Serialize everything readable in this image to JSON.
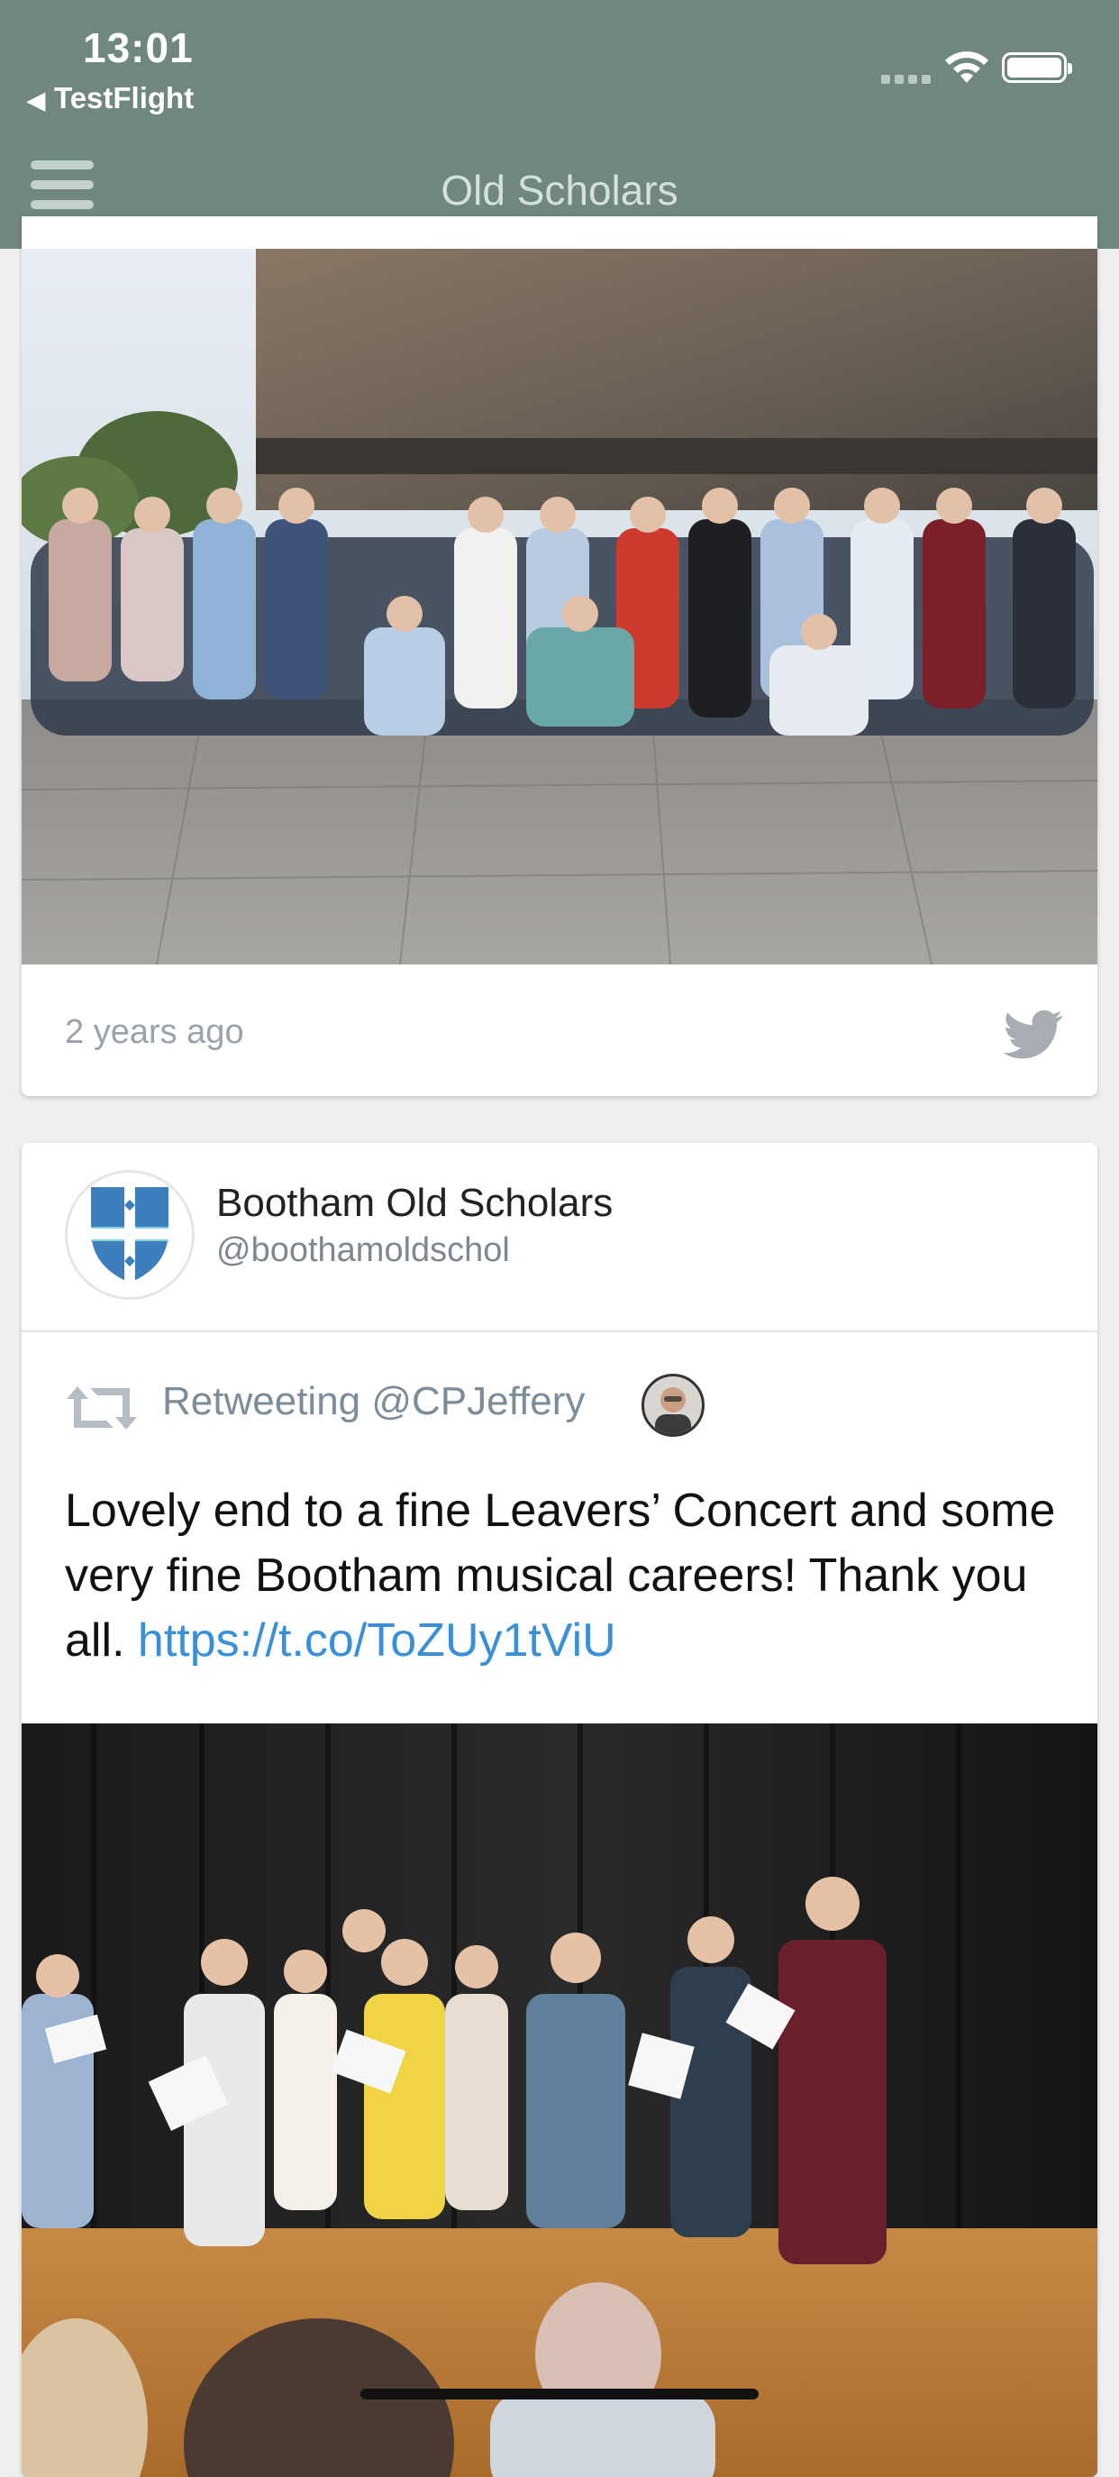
{
  "status_bar": {
    "time": "13:01",
    "back_app": "TestFlight"
  },
  "header": {
    "title": "Old Scholars",
    "menu_icon": "hamburger-menu-icon"
  },
  "colors": {
    "header_bg": "#6f877f",
    "link": "#3a8fd6",
    "meta_text": "#9aa3ad"
  },
  "feed": {
    "post1": {
      "time_ago": "2 years ago",
      "source_icon": "twitter-icon"
    },
    "post2": {
      "author_name": "Bootham Old Scholars",
      "author_handle": "@boothamoldschol",
      "retweet_label": "Retweeting @CPJeffery",
      "text": "Lovely end to a fine Leavers’ Concert and some very fine Bootham musical careers! Thank you all. ",
      "link": "https://t.co/ToZUy1tViU"
    }
  }
}
